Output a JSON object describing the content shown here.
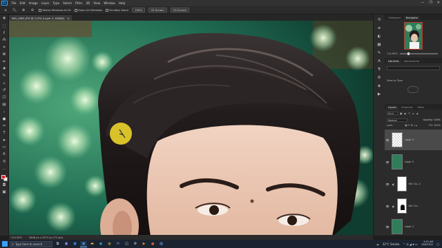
{
  "app": {
    "logo": "Ps"
  },
  "menu": [
    "File",
    "Edit",
    "Image",
    "Layer",
    "Type",
    "Select",
    "Filter",
    "3D",
    "View",
    "Window",
    "Help"
  ],
  "window_controls": [
    "—",
    "❐",
    "✕"
  ],
  "options_bar": {
    "resize_windows": "Resize Windows to Fit",
    "zoom_all": "Zoom All Windows",
    "scrubby_zoom": "Scrubby Zoom",
    "zoom_value": "100%",
    "fit_screen": "Fit Screen",
    "fill_screen": "Fill Screen"
  },
  "document": {
    "tab_title": "IMG_4981.JPG @ 115% (Layer 3, RGB/8)",
    "tab_close": "×"
  },
  "status": {
    "zoom": "114.99%",
    "doc_info": "3648 px x 3072 px (72 ppi)"
  },
  "navigator": {
    "tabs": [
      "Histogram",
      "Navigator"
    ],
    "active": "Navigator",
    "zoom": "114.99%",
    "zoom_fraction": 0.22
  },
  "libraries": {
    "tabs": [
      "Libraries",
      "Adjustments"
    ],
    "active": "Libraries",
    "view_by": "View by Type"
  },
  "layers": {
    "tabs": [
      "Layers",
      "Channels",
      "Paths"
    ],
    "active": "Layers",
    "kind_filter": "Kind",
    "blend_mode": "Normal",
    "opacity_label": "Opacity:",
    "opacity": "100%",
    "lock_label": "Lock:",
    "fill_label": "Fill:",
    "fill": "100%",
    "items": [
      {
        "name": "Layer 3",
        "type": "empty",
        "selected": true
      },
      {
        "name": "Layer 2",
        "type": "photo",
        "selected": false
      },
      {
        "name": "Sel. Co...1",
        "type": "adjustment",
        "selected": false
      },
      {
        "name": "Sel. Co...",
        "type": "adjustment-mask",
        "selected": false
      },
      {
        "name": "Layer 1",
        "type": "photo",
        "selected": false
      }
    ]
  },
  "taskbar": {
    "search_placeholder": "Type here to search",
    "apps": [
      "task-view",
      "cortana",
      "premiere",
      "photoshop",
      "explorer",
      "edge",
      "chrome",
      "mail",
      "store",
      "settings",
      "media",
      "firefox",
      "photos"
    ],
    "weather": "32°C  Smoke",
    "time": "4:52 AM",
    "date": "19/6/2022"
  },
  "colors": {
    "foreground": "#e02020",
    "background": "#ffffff",
    "accent": "#31a8ff",
    "brush_cursor": "#e3c92a"
  }
}
